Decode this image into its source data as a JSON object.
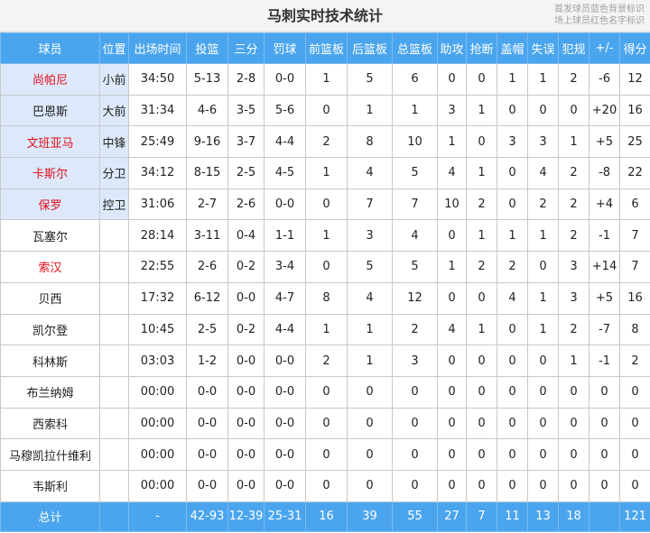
{
  "title": "马刺实时技术统计",
  "legend": {
    "starter_note": "首发球员蓝色背景标识",
    "oncourt_note": "场上球员红色名字标识"
  },
  "colors": {
    "header_bg": "#4aa5ee",
    "starter_bg": "#dde9fb",
    "oncourt_name": "#e3101a"
  },
  "columns": [
    "球员",
    "位置",
    "出场时间",
    "投篮",
    "三分",
    "罚球",
    "前篮板",
    "后篮板",
    "总篮板",
    "助攻",
    "抢断",
    "盖帽",
    "失误",
    "犯规",
    "+/-",
    "得分"
  ],
  "players": [
    {
      "name": "尚帕尼",
      "pos": "小前",
      "min": "34:50",
      "fg": "5-13",
      "tp": "2-8",
      "ft": "0-0",
      "oreb": "1",
      "dreb": "5",
      "reb": "6",
      "ast": "0",
      "stl": "0",
      "blk": "1",
      "tov": "1",
      "pf": "2",
      "pm": "-6",
      "pts": "12",
      "starter": true,
      "oncourt": true
    },
    {
      "name": "巴恩斯",
      "pos": "大前",
      "min": "31:34",
      "fg": "4-6",
      "tp": "3-5",
      "ft": "5-6",
      "oreb": "0",
      "dreb": "1",
      "reb": "1",
      "ast": "3",
      "stl": "1",
      "blk": "0",
      "tov": "0",
      "pf": "0",
      "pm": "+20",
      "pts": "16",
      "starter": true,
      "oncourt": false
    },
    {
      "name": "文班亚马",
      "pos": "中锋",
      "min": "25:49",
      "fg": "9-16",
      "tp": "3-7",
      "ft": "4-4",
      "oreb": "2",
      "dreb": "8",
      "reb": "10",
      "ast": "1",
      "stl": "0",
      "blk": "3",
      "tov": "3",
      "pf": "1",
      "pm": "+5",
      "pts": "25",
      "starter": true,
      "oncourt": true
    },
    {
      "name": "卡斯尔",
      "pos": "分卫",
      "min": "34:12",
      "fg": "8-15",
      "tp": "2-5",
      "ft": "4-5",
      "oreb": "1",
      "dreb": "4",
      "reb": "5",
      "ast": "4",
      "stl": "1",
      "blk": "0",
      "tov": "4",
      "pf": "2",
      "pm": "-8",
      "pts": "22",
      "starter": true,
      "oncourt": true
    },
    {
      "name": "保罗",
      "pos": "控卫",
      "min": "31:06",
      "fg": "2-7",
      "tp": "2-6",
      "ft": "0-0",
      "oreb": "0",
      "dreb": "7",
      "reb": "7",
      "ast": "10",
      "stl": "2",
      "blk": "0",
      "tov": "2",
      "pf": "2",
      "pm": "+4",
      "pts": "6",
      "starter": true,
      "oncourt": true
    },
    {
      "name": "瓦塞尔",
      "pos": "",
      "min": "28:14",
      "fg": "3-11",
      "tp": "0-4",
      "ft": "1-1",
      "oreb": "1",
      "dreb": "3",
      "reb": "4",
      "ast": "0",
      "stl": "1",
      "blk": "1",
      "tov": "1",
      "pf": "2",
      "pm": "-1",
      "pts": "7",
      "starter": false,
      "oncourt": false
    },
    {
      "name": "索汉",
      "pos": "",
      "min": "22:55",
      "fg": "2-6",
      "tp": "0-2",
      "ft": "3-4",
      "oreb": "0",
      "dreb": "5",
      "reb": "5",
      "ast": "1",
      "stl": "2",
      "blk": "2",
      "tov": "0",
      "pf": "3",
      "pm": "+14",
      "pts": "7",
      "starter": false,
      "oncourt": true
    },
    {
      "name": "贝西",
      "pos": "",
      "min": "17:32",
      "fg": "6-12",
      "tp": "0-0",
      "ft": "4-7",
      "oreb": "8",
      "dreb": "4",
      "reb": "12",
      "ast": "0",
      "stl": "0",
      "blk": "4",
      "tov": "1",
      "pf": "3",
      "pm": "+5",
      "pts": "16",
      "starter": false,
      "oncourt": false
    },
    {
      "name": "凯尔登",
      "pos": "",
      "min": "10:45",
      "fg": "2-5",
      "tp": "0-2",
      "ft": "4-4",
      "oreb": "1",
      "dreb": "1",
      "reb": "2",
      "ast": "4",
      "stl": "1",
      "blk": "0",
      "tov": "1",
      "pf": "2",
      "pm": "-7",
      "pts": "8",
      "starter": false,
      "oncourt": false
    },
    {
      "name": "科林斯",
      "pos": "",
      "min": "03:03",
      "fg": "1-2",
      "tp": "0-0",
      "ft": "0-0",
      "oreb": "2",
      "dreb": "1",
      "reb": "3",
      "ast": "0",
      "stl": "0",
      "blk": "0",
      "tov": "0",
      "pf": "1",
      "pm": "-1",
      "pts": "2",
      "starter": false,
      "oncourt": false
    },
    {
      "name": "布兰纳姆",
      "pos": "",
      "min": "00:00",
      "fg": "0-0",
      "tp": "0-0",
      "ft": "0-0",
      "oreb": "0",
      "dreb": "0",
      "reb": "0",
      "ast": "0",
      "stl": "0",
      "blk": "0",
      "tov": "0",
      "pf": "0",
      "pm": "0",
      "pts": "0",
      "starter": false,
      "oncourt": false
    },
    {
      "name": "西索科",
      "pos": "",
      "min": "00:00",
      "fg": "0-0",
      "tp": "0-0",
      "ft": "0-0",
      "oreb": "0",
      "dreb": "0",
      "reb": "0",
      "ast": "0",
      "stl": "0",
      "blk": "0",
      "tov": "0",
      "pf": "0",
      "pm": "0",
      "pts": "0",
      "starter": false,
      "oncourt": false
    },
    {
      "name": "马穆凯拉什维利",
      "pos": "",
      "min": "00:00",
      "fg": "0-0",
      "tp": "0-0",
      "ft": "0-0",
      "oreb": "0",
      "dreb": "0",
      "reb": "0",
      "ast": "0",
      "stl": "0",
      "blk": "0",
      "tov": "0",
      "pf": "0",
      "pm": "0",
      "pts": "0",
      "starter": false,
      "oncourt": false
    },
    {
      "name": "韦斯利",
      "pos": "",
      "min": "00:00",
      "fg": "0-0",
      "tp": "0-0",
      "ft": "0-0",
      "oreb": "0",
      "dreb": "0",
      "reb": "0",
      "ast": "0",
      "stl": "0",
      "blk": "0",
      "tov": "0",
      "pf": "0",
      "pm": "0",
      "pts": "0",
      "starter": false,
      "oncourt": false
    }
  ],
  "totals": {
    "label": "总计",
    "pos": "",
    "min": "-",
    "fg": "42-93",
    "tp": "12-39",
    "ft": "25-31",
    "oreb": "16",
    "dreb": "39",
    "reb": "55",
    "ast": "27",
    "stl": "7",
    "blk": "11",
    "tov": "13",
    "pf": "18",
    "pm": "",
    "pts": "121"
  }
}
